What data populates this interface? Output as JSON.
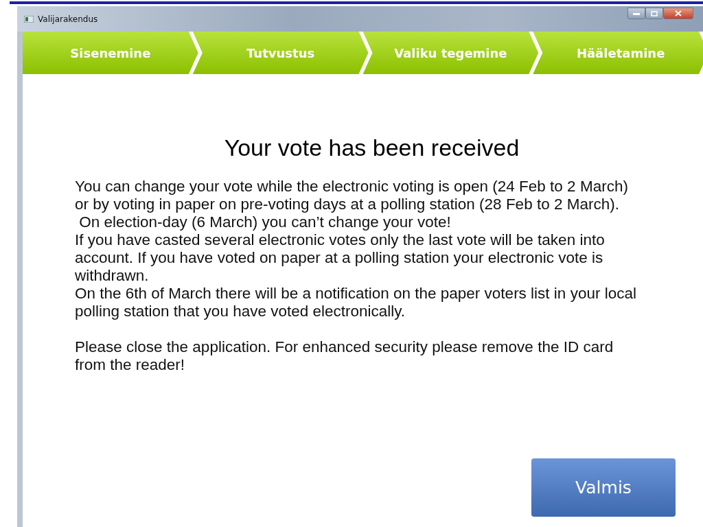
{
  "window": {
    "title": "Valijarakendus"
  },
  "steps": [
    {
      "label": "Sisenemine"
    },
    {
      "label": "Tutvustus"
    },
    {
      "label": "Valiku tegemine"
    },
    {
      "label": "Hääletamine"
    }
  ],
  "heading": "Your vote has been received",
  "paragraphs": [
    {
      "lines": [
        "You can change your vote while the electronic voting is open (24 Feb to 2 March)",
        "or by voting in paper on pre-voting days at a polling station (28 Feb to 2 March).",
        " On election-day (6 March) you can’t change your vote!",
        "If you have casted several electronic votes only the last vote will be taken into",
        "account.  If you have voted on paper at a polling station your electronic vote is",
        "withdrawn.",
        "On the 6th of March there will be a notification on the paper voters list in your local",
        "polling station that you have voted electronically."
      ]
    },
    {
      "lines": [
        "Please close the application. For enhanced security please remove the ID card",
        "from the reader!"
      ]
    }
  ],
  "done_button": "Valmis"
}
